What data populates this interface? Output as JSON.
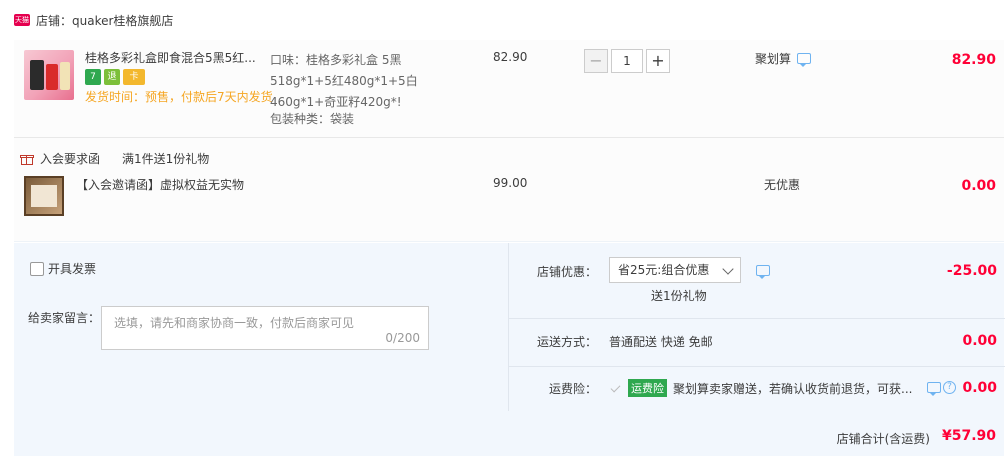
{
  "shop": {
    "badge": "天猫",
    "name": "店铺：quaker桂格旗舰店"
  },
  "item": {
    "title": "桂格多彩礼盒即食混合5黑5红...",
    "ship_time": "发货时间：预售，付款后7天内发货",
    "sku_line": "口味：桂格多彩礼盒 5黑518g*1+5红480g*1+5白460g*1+奇亚籽420g*!",
    "pack": "包装种类：袋装",
    "unit_price": "82.90",
    "qty_minus": "−",
    "qty": "1",
    "qty_plus": "+",
    "promo": "聚划算",
    "total": "82.90",
    "service_icons": [
      "7",
      "退",
      "卡"
    ]
  },
  "gift": {
    "head_label": "入会要求函",
    "head_rule": "满1件送1份礼物",
    "title": "【入会邀请函】虚拟权益无实物",
    "price": "99.00",
    "promo": "无优惠",
    "total": "0.00"
  },
  "invoice": {
    "label": "开具发票"
  },
  "memo": {
    "label": "给卖家留言：",
    "placeholder": "选填，请先和商家协商一致，付款后商家可见",
    "count": "0/200"
  },
  "shop_discount": {
    "label": "店铺优惠：",
    "selected": "省25元:组合优惠",
    "sub": "送1份礼物",
    "value": "-25.00"
  },
  "shipping": {
    "label": "运送方式：",
    "method": "普通配送 快递 免邮",
    "value": "0.00"
  },
  "insurance": {
    "label": "运费险：",
    "badge": "运费险",
    "text": "聚划算卖家赠送，若确认收货前退货，可获...",
    "value": "0.00"
  },
  "total": {
    "label": "店铺合计(含运费)",
    "value": "¥57.90"
  },
  "colors": {
    "price_red": "#ff0036",
    "ship_time_orange": "#f5a623",
    "bottom_bg": "#f2f7fd"
  }
}
